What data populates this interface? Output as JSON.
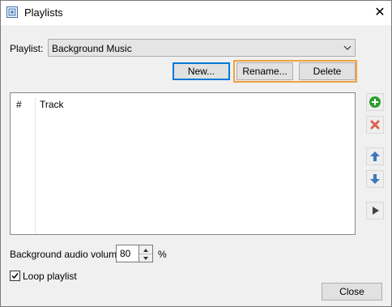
{
  "window": {
    "title": "Playlists",
    "close_glyph": "✕"
  },
  "playlist": {
    "label": "Playlist:",
    "selected": "Background Music"
  },
  "buttons": {
    "new": "New...",
    "rename": "Rename...",
    "delete": "Delete",
    "close": "Close"
  },
  "track_list": {
    "columns": [
      "#",
      "Track"
    ],
    "rows": []
  },
  "side_buttons": [
    {
      "name": "add-track",
      "icon": "plus-circle-icon",
      "color": "#2e9e2e"
    },
    {
      "name": "remove-track",
      "icon": "x-icon",
      "color": "#e06050"
    },
    {
      "name": "move-up",
      "icon": "arrow-up-icon",
      "color": "#3a78c0"
    },
    {
      "name": "move-down",
      "icon": "arrow-down-icon",
      "color": "#3a78c0"
    },
    {
      "name": "play",
      "icon": "play-icon",
      "color": "#444444"
    }
  ],
  "volume": {
    "label": "Background audio volume:",
    "value": "80",
    "unit": "%"
  },
  "loop": {
    "label": "Loop playlist",
    "checked": true
  },
  "colors": {
    "focus_border": "#0078d7",
    "highlight_border": "#f0a040"
  }
}
